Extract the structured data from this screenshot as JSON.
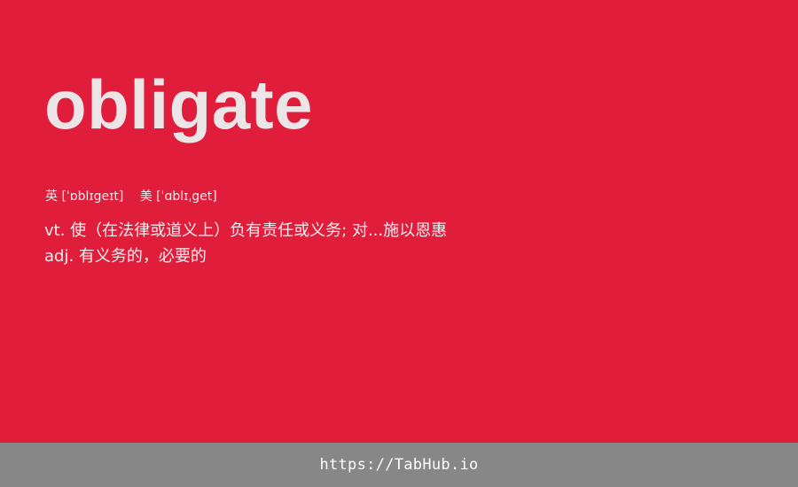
{
  "colors": {
    "background": "#e01e3c",
    "footer": "#878787",
    "word": "#ebe5e7",
    "text": "#f6ecee"
  },
  "entry": {
    "word": "obligate",
    "phonetics": {
      "uk": "英 [ˈɒblɪgeɪt]",
      "us": "美 [ˈɑblɪˌget]"
    },
    "definitions": [
      "vt. 使（在法律或道义上）负有责任或义务; 对...施以恩惠",
      "adj. 有义务的，必要的"
    ]
  },
  "footer": {
    "link": "https://TabHub.io"
  }
}
